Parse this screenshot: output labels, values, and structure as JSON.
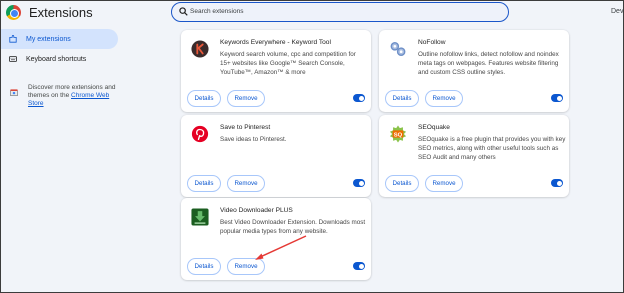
{
  "header": {
    "title": "Extensions",
    "search_placeholder": "Search extensions",
    "dev_label": "Dev"
  },
  "sidebar": {
    "items": [
      {
        "label": "My extensions",
        "icon": "puzzle-icon",
        "active": true
      },
      {
        "label": "Keyboard shortcuts",
        "icon": "keyboard-icon",
        "active": false
      }
    ],
    "discover_text": "Discover more extensions and themes on the",
    "store_link": "Chrome Web Store",
    "discover_icon": "store-icon"
  },
  "buttons": {
    "details": "Details",
    "remove": "Remove"
  },
  "extensions": [
    {
      "name": "Keywords Everywhere - Keyword Tool",
      "description": "Keyword search volume, cpc and competition for 15+ websites like Google™ Search Console, YouTube™, Amazon™ & more",
      "icon": "keywords-everywhere-logo-icon",
      "icon_color": "#3b2b2b",
      "enabled": true
    },
    {
      "name": "NoFollow",
      "description": "Outline nofollow links, detect nofollow and noindex meta tags on webpages. Features website filtering and custom CSS outline styles.",
      "icon": "nofollow-chain-icon",
      "icon_color": "#6d8fc7",
      "enabled": true
    },
    {
      "name": "Save to Pinterest",
      "description": "Save ideas to Pinterest.",
      "icon": "pinterest-logo-icon",
      "icon_color": "#e60023",
      "enabled": true
    },
    {
      "name": "SEOquake",
      "description": "SEOquake is a free plugin that provides you with key SEO metrics, along with other useful tools such as SEO Audit and many others",
      "icon": "seoquake-logo-icon",
      "icon_color": "#e67e22",
      "enabled": true
    },
    {
      "name": "Video Downloader PLUS",
      "description": "Best Video Downloader Extension. Downloads most popular media types from any website.",
      "icon": "download-arrow-icon",
      "icon_color": "#2e7d32",
      "enabled": true
    }
  ],
  "colors": {
    "accent": "#0b57d0",
    "annotation_arrow": "#e53935",
    "page_background": "#f1f4f9"
  }
}
